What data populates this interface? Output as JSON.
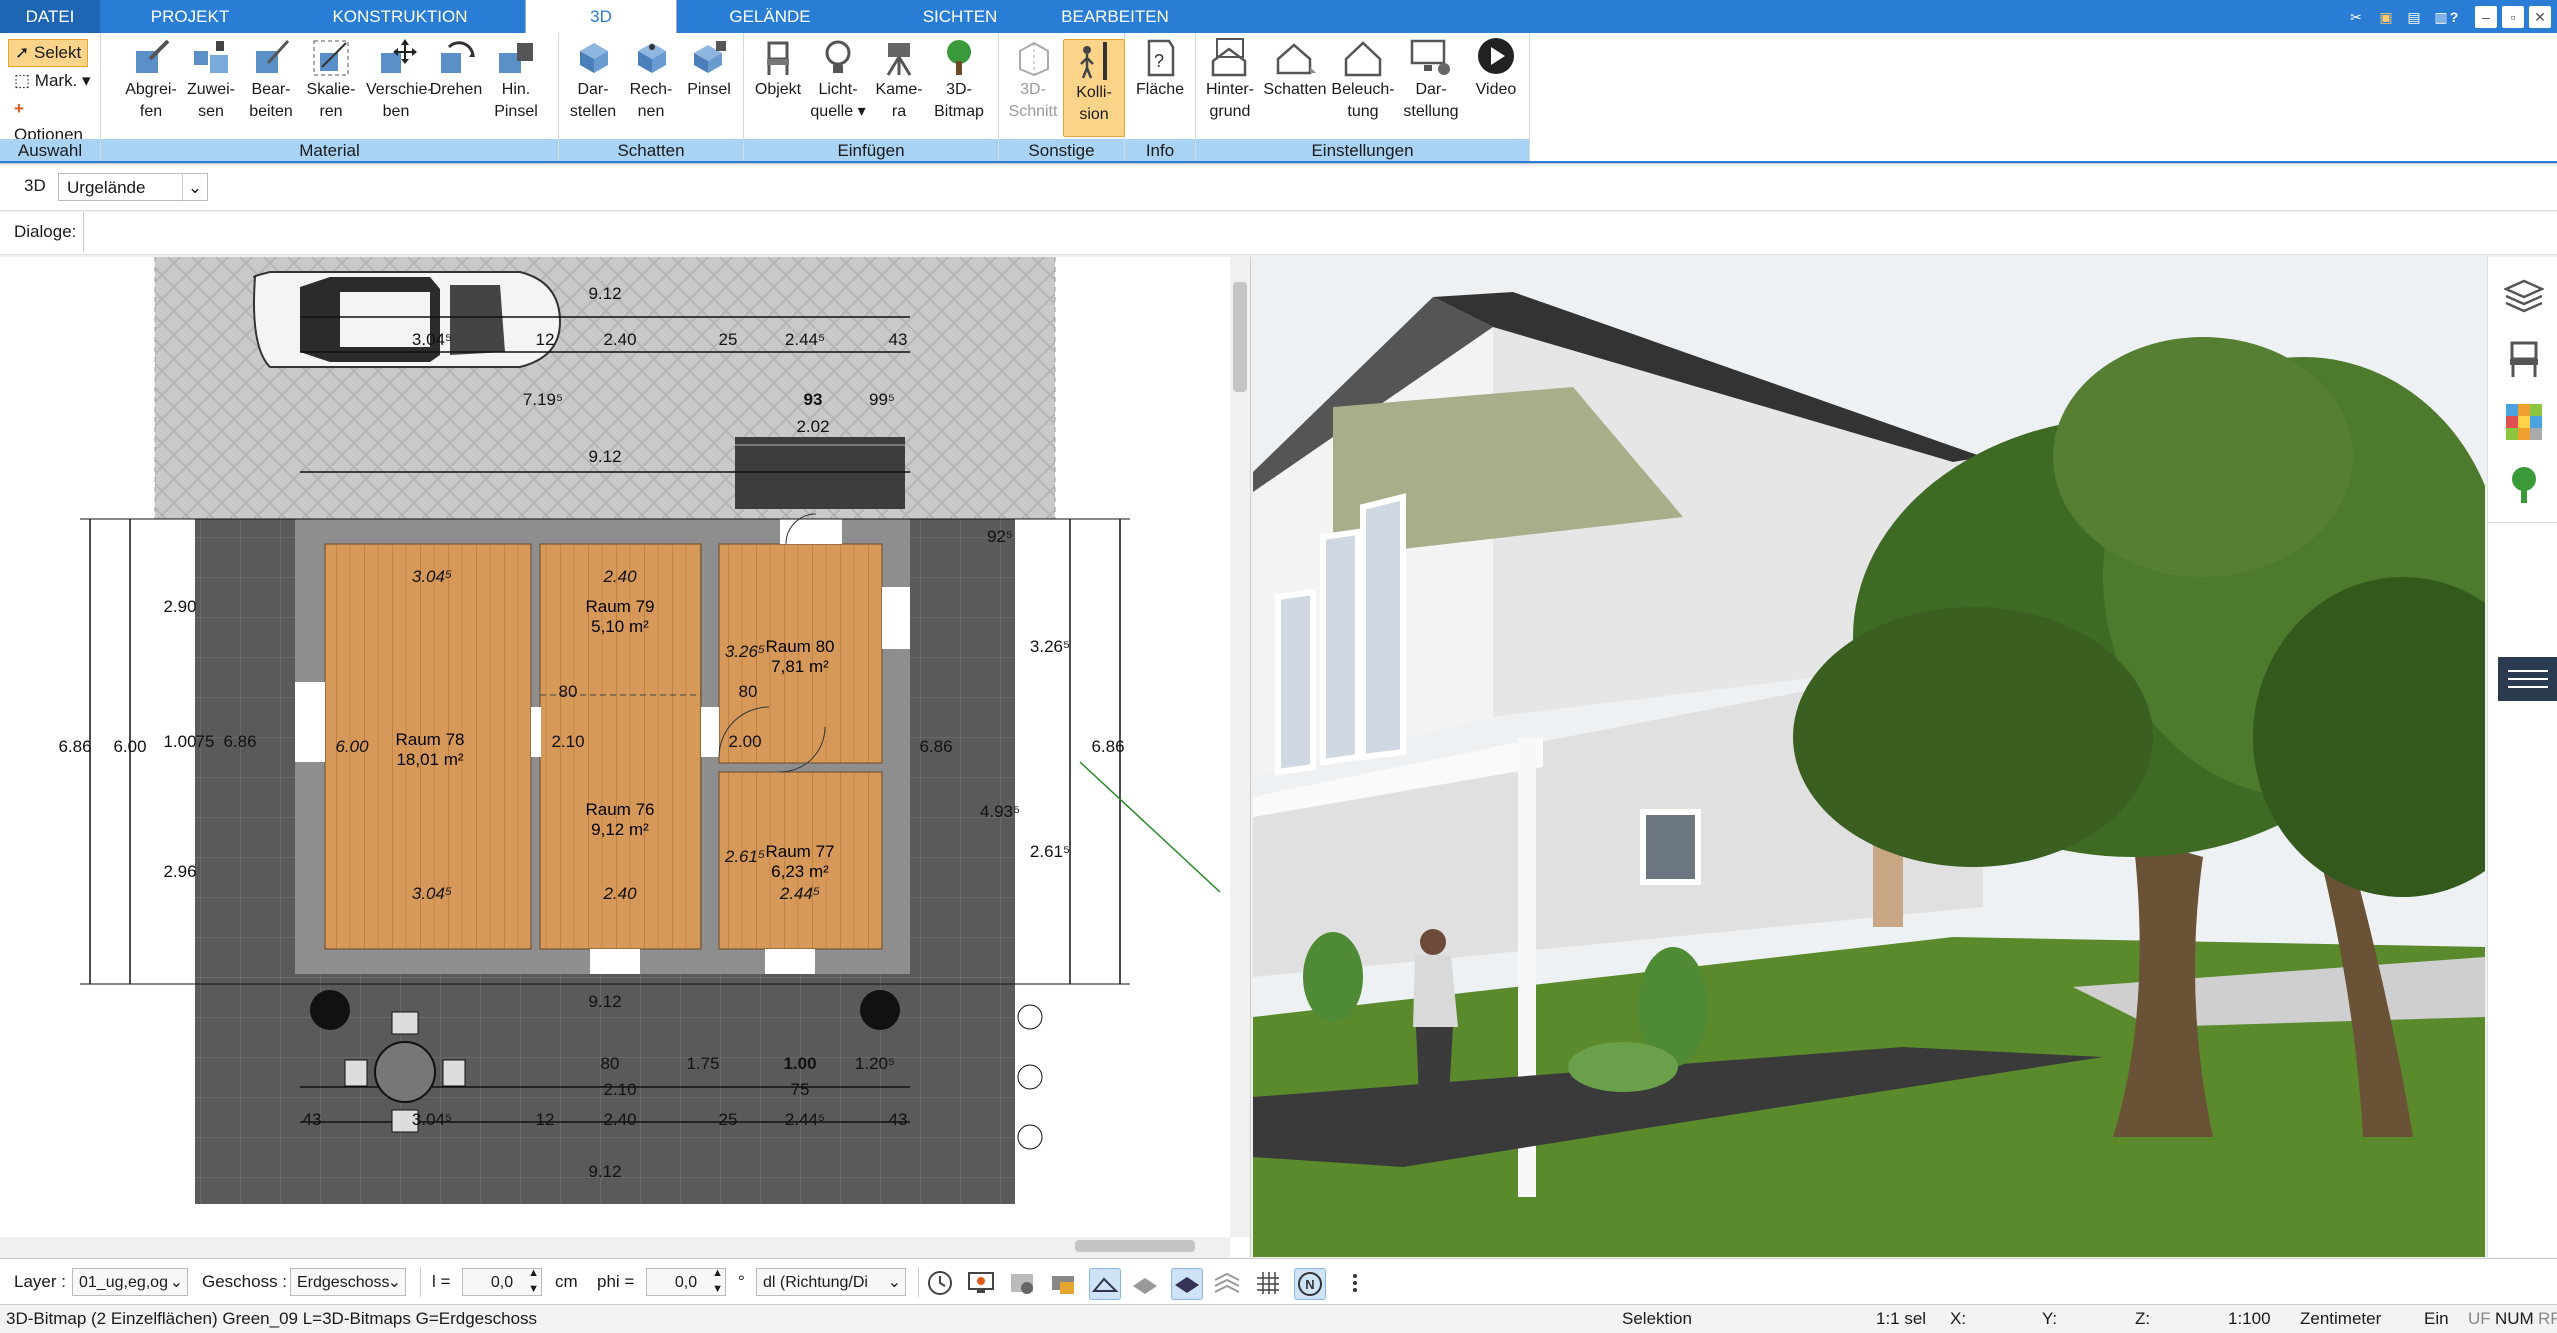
{
  "menu_tabs": [
    {
      "label": "DATEI"
    },
    {
      "label": "PROJEKT"
    },
    {
      "label": "KONSTRUKTION"
    },
    {
      "label": "3D"
    },
    {
      "label": "GELÄNDE"
    },
    {
      "label": "SICHTEN"
    },
    {
      "label": "BEARBEITEN"
    }
  ],
  "ribbon": {
    "auswahl": {
      "select": "Selekt",
      "mark": "Mark.",
      "options": "Optionen",
      "group": "Auswahl"
    },
    "material": {
      "group": "Material",
      "buttons": [
        {
          "l1": "Abgrei-",
          "l2": "fen"
        },
        {
          "l1": "Zuwei-",
          "l2": "sen"
        },
        {
          "l1": "Bear-",
          "l2": "beiten"
        },
        {
          "l1": "Skalie-",
          "l2": "ren"
        },
        {
          "l1": "Verschie-",
          "l2": "ben"
        },
        {
          "l1": "Drehen",
          "l2": ""
        },
        {
          "l1": "Hin.",
          "l2": "Pinsel"
        }
      ]
    },
    "schatten": {
      "group": "Schatten",
      "buttons": [
        {
          "l1": "Dar-",
          "l2": "stellen"
        },
        {
          "l1": "Rech-",
          "l2": "nen"
        },
        {
          "l1": "Pinsel",
          "l2": ""
        }
      ]
    },
    "einfuegen": {
      "group": "Einfügen",
      "buttons": [
        {
          "l1": "Objekt",
          "l2": ""
        },
        {
          "l1": "Licht-",
          "l2": "quelle"
        },
        {
          "l1": "Kame-",
          "l2": "ra"
        },
        {
          "l1": "3D-",
          "l2": "Bitmap"
        }
      ]
    },
    "sonstige": {
      "group": "Sonstige",
      "buttons": [
        {
          "l1": "3D-",
          "l2": "Schnitt"
        },
        {
          "l1": "Kolli-",
          "l2": "sion"
        }
      ]
    },
    "info": {
      "group": "Info",
      "buttons": [
        {
          "l1": "Fläche",
          "l2": ""
        }
      ]
    },
    "einstellungen": {
      "group": "Einstellungen",
      "buttons": [
        {
          "l1": "Hinter-",
          "l2": "grund"
        },
        {
          "l1": "Schatten",
          "l2": ""
        },
        {
          "l1": "Beleuch-",
          "l2": "tung"
        },
        {
          "l1": "Dar-",
          "l2": "stellung"
        },
        {
          "l1": "Video",
          "l2": ""
        }
      ]
    }
  },
  "view_row": {
    "mode": "3D",
    "terrain": "Urgelände"
  },
  "dialog_row": {
    "label": "Dialoge:"
  },
  "plan": {
    "rooms": [
      {
        "name": "Raum 78",
        "area": "18,01 m²"
      },
      {
        "name": "Raum 79",
        "area": "5,10 m²"
      },
      {
        "name": "Raum 80",
        "area": "7,81 m²"
      },
      {
        "name": "Raum 76",
        "area": "9,12 m²"
      },
      {
        "name": "Raum 77",
        "area": "6,23 m²"
      }
    ],
    "dims": [
      "9.12",
      "2.40",
      "25",
      "2.44⁵",
      "43",
      "3.04⁵",
      "12",
      "7.19⁵",
      "93",
      "99⁵",
      "2.02",
      "3.04⁵",
      "2.40",
      "2.44⁵",
      "3.26⁵",
      "2.61⁵",
      "6.00",
      "2.90",
      "1.00",
      "75",
      "6.86",
      "2.96",
      "80",
      "2.00",
      "2.10",
      "1.75",
      "1.20⁵",
      "4.93⁵",
      "92⁵",
      "3.26⁵"
    ]
  },
  "bottom": {
    "layer_label": "Layer :",
    "layer_value": "01_ug,eg,og",
    "geschoss_label": "Geschoss :",
    "geschoss_value": "Erdgeschoss",
    "l_label": "l =",
    "l_value": "0,0",
    "l_unit": "cm",
    "phi_label": "phi =",
    "phi_value": "0,0",
    "phi_unit": "°",
    "dl_value": "dl (Richtung/Di"
  },
  "status": {
    "info": "3D-Bitmap (2 Einzelflächen) Green_09 L=3D-Bitmaps G=Erdgeschoss",
    "mode": "Selektion",
    "sel": "1:1 sel",
    "x": "X:",
    "y": "Y:",
    "z": "Z:",
    "scale": "1:100",
    "unit": "Zentimeter",
    "ein": "Ein",
    "uf": "UF",
    "num": "NUM",
    "rf": "RF"
  }
}
